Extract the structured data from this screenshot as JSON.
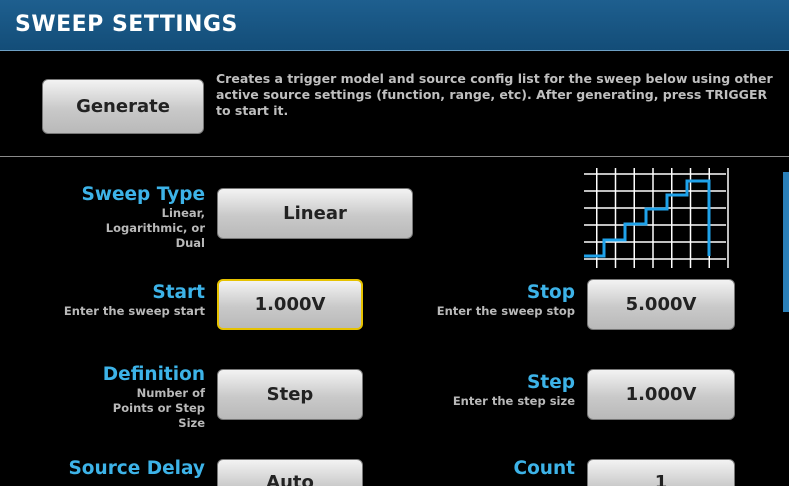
{
  "header": {
    "title": "SWEEP SETTINGS"
  },
  "generate": {
    "label": "Generate",
    "description": "Creates a trigger model and source config list for the sweep below using other active source settings (function, range, etc). After generating, press TRIGGER to start it."
  },
  "fields": {
    "sweep_type": {
      "title": "Sweep Type",
      "sub": "Linear, Logarithmic, or Dual",
      "value": "Linear"
    },
    "start": {
      "title": "Start",
      "sub": "Enter the sweep start",
      "value": "1.000V"
    },
    "stop": {
      "title": "Stop",
      "sub": "Enter the sweep stop",
      "value": "5.000V"
    },
    "definition": {
      "title": "Definition",
      "sub": "Number of Points or Step Size",
      "value": "Step"
    },
    "step": {
      "title": "Step",
      "sub": "Enter the step size",
      "value": "1.000V"
    },
    "source_delay": {
      "title": "Source Delay",
      "value": "Auto"
    },
    "count": {
      "title": "Count",
      "value": "1"
    }
  },
  "preview_graph": {
    "type": "staircase",
    "color": "#1fa2ea",
    "grid_color": "#ffffff"
  },
  "colors": {
    "accent": "#3db3e8",
    "header_bg": "#1a5a88",
    "selected_border": "#e6c200"
  }
}
